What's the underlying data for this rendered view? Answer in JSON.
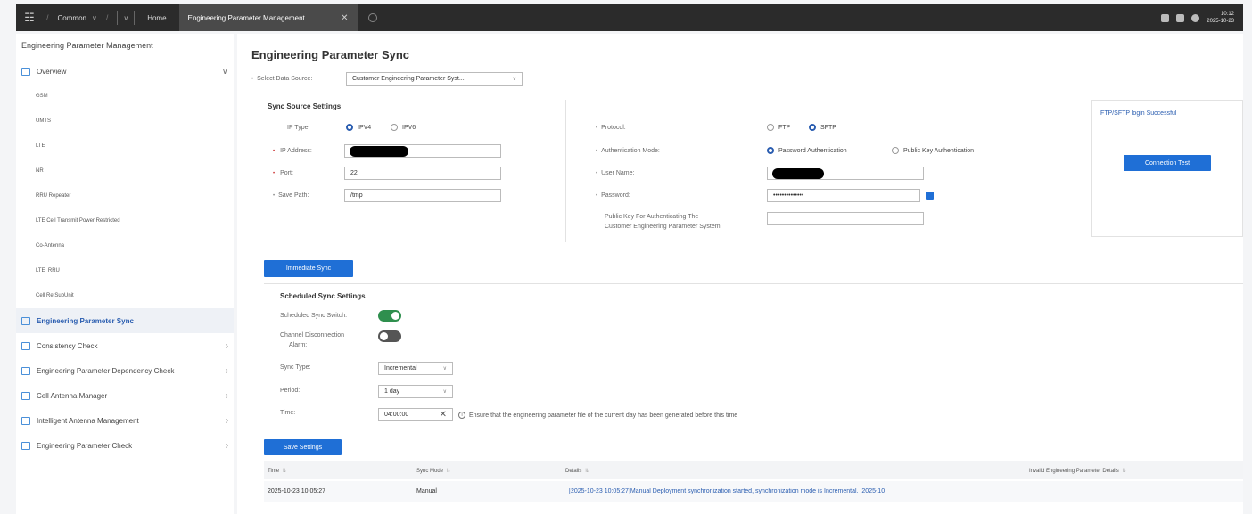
{
  "topbar": {
    "menu_label": "Common",
    "home_label": "Home",
    "active_tab_label": "Engineering Parameter Management",
    "clock_time": "10:12",
    "clock_date": "2025-10-23"
  },
  "sidebar": {
    "title": "Engineering Parameter Management",
    "overview_label": "Overview",
    "overview_children": [
      "GSM",
      "UMTS",
      "LTE",
      "NR",
      "RRU Repeater",
      "LTE Cell Transmit Power Restricted",
      "Co-Antenna",
      "LTE_RRU",
      "Cell RetSubUnit"
    ],
    "items": [
      {
        "label": "Engineering Parameter Sync",
        "active": true
      },
      {
        "label": "Consistency Check"
      },
      {
        "label": "Engineering Parameter Dependency Check"
      },
      {
        "label": "Cell Antenna Manager"
      },
      {
        "label": "Intelligent Antenna Management"
      },
      {
        "label": "Engineering Parameter Check"
      }
    ]
  },
  "page": {
    "title": "Engineering Parameter Sync",
    "data_source_label": "Select Data Source:",
    "data_source_value": "Customer Engineering Parameter Syst..."
  },
  "sync_source": {
    "title": "Sync Source Settings",
    "ip_type_label": "IP Type:",
    "ipv4": "IPV4",
    "ipv6": "IPV6",
    "ip_address_label": "IP Address:",
    "port_label": "Port:",
    "port_value": "22",
    "save_path_label": "Save Path:",
    "save_path_value": "/tmp",
    "protocol_label": "Protocol:",
    "ftp": "FTP",
    "sftp": "SFTP",
    "auth_mode_label": "Authentication Mode:",
    "auth_password": "Password Authentication",
    "auth_public_key": "Public Key Authentication",
    "user_name_label": "User Name:",
    "password_label": "Password:",
    "password_value": "••••••••••••••",
    "public_key_label_1": "Public Key For Authenticating The",
    "public_key_label_2": "Customer Engineering Parameter System:"
  },
  "connection": {
    "status": "FTP/SFTP login Successful",
    "test_button": "Connection Test"
  },
  "immediate_sync_button": "Immediate Sync",
  "scheduled": {
    "title": "Scheduled Sync Settings",
    "switch_label": "Scheduled Sync Switch:",
    "channel_label_1": "Channel Disconnection",
    "channel_label_2": "Alarm:",
    "sync_type_label": "Sync Type:",
    "sync_type_value": "Incremental",
    "period_label": "Period:",
    "period_value": "1 day",
    "time_label": "Time:",
    "time_value": "04:00:00",
    "hint": "Ensure that the engineering parameter file of the current day has been generated before this time"
  },
  "save_button": "Save Settings",
  "table": {
    "headers": [
      "Time",
      "Sync Mode",
      "Details",
      "Invalid Engineering Parameter Details"
    ],
    "rows": [
      [
        "2025-10-23 10:05:27",
        "Manual",
        "[2025-10-23 10:05:27]Manual Deployment synchronization started, synchronization mode is Incremental. [2025-10"
      ]
    ]
  }
}
